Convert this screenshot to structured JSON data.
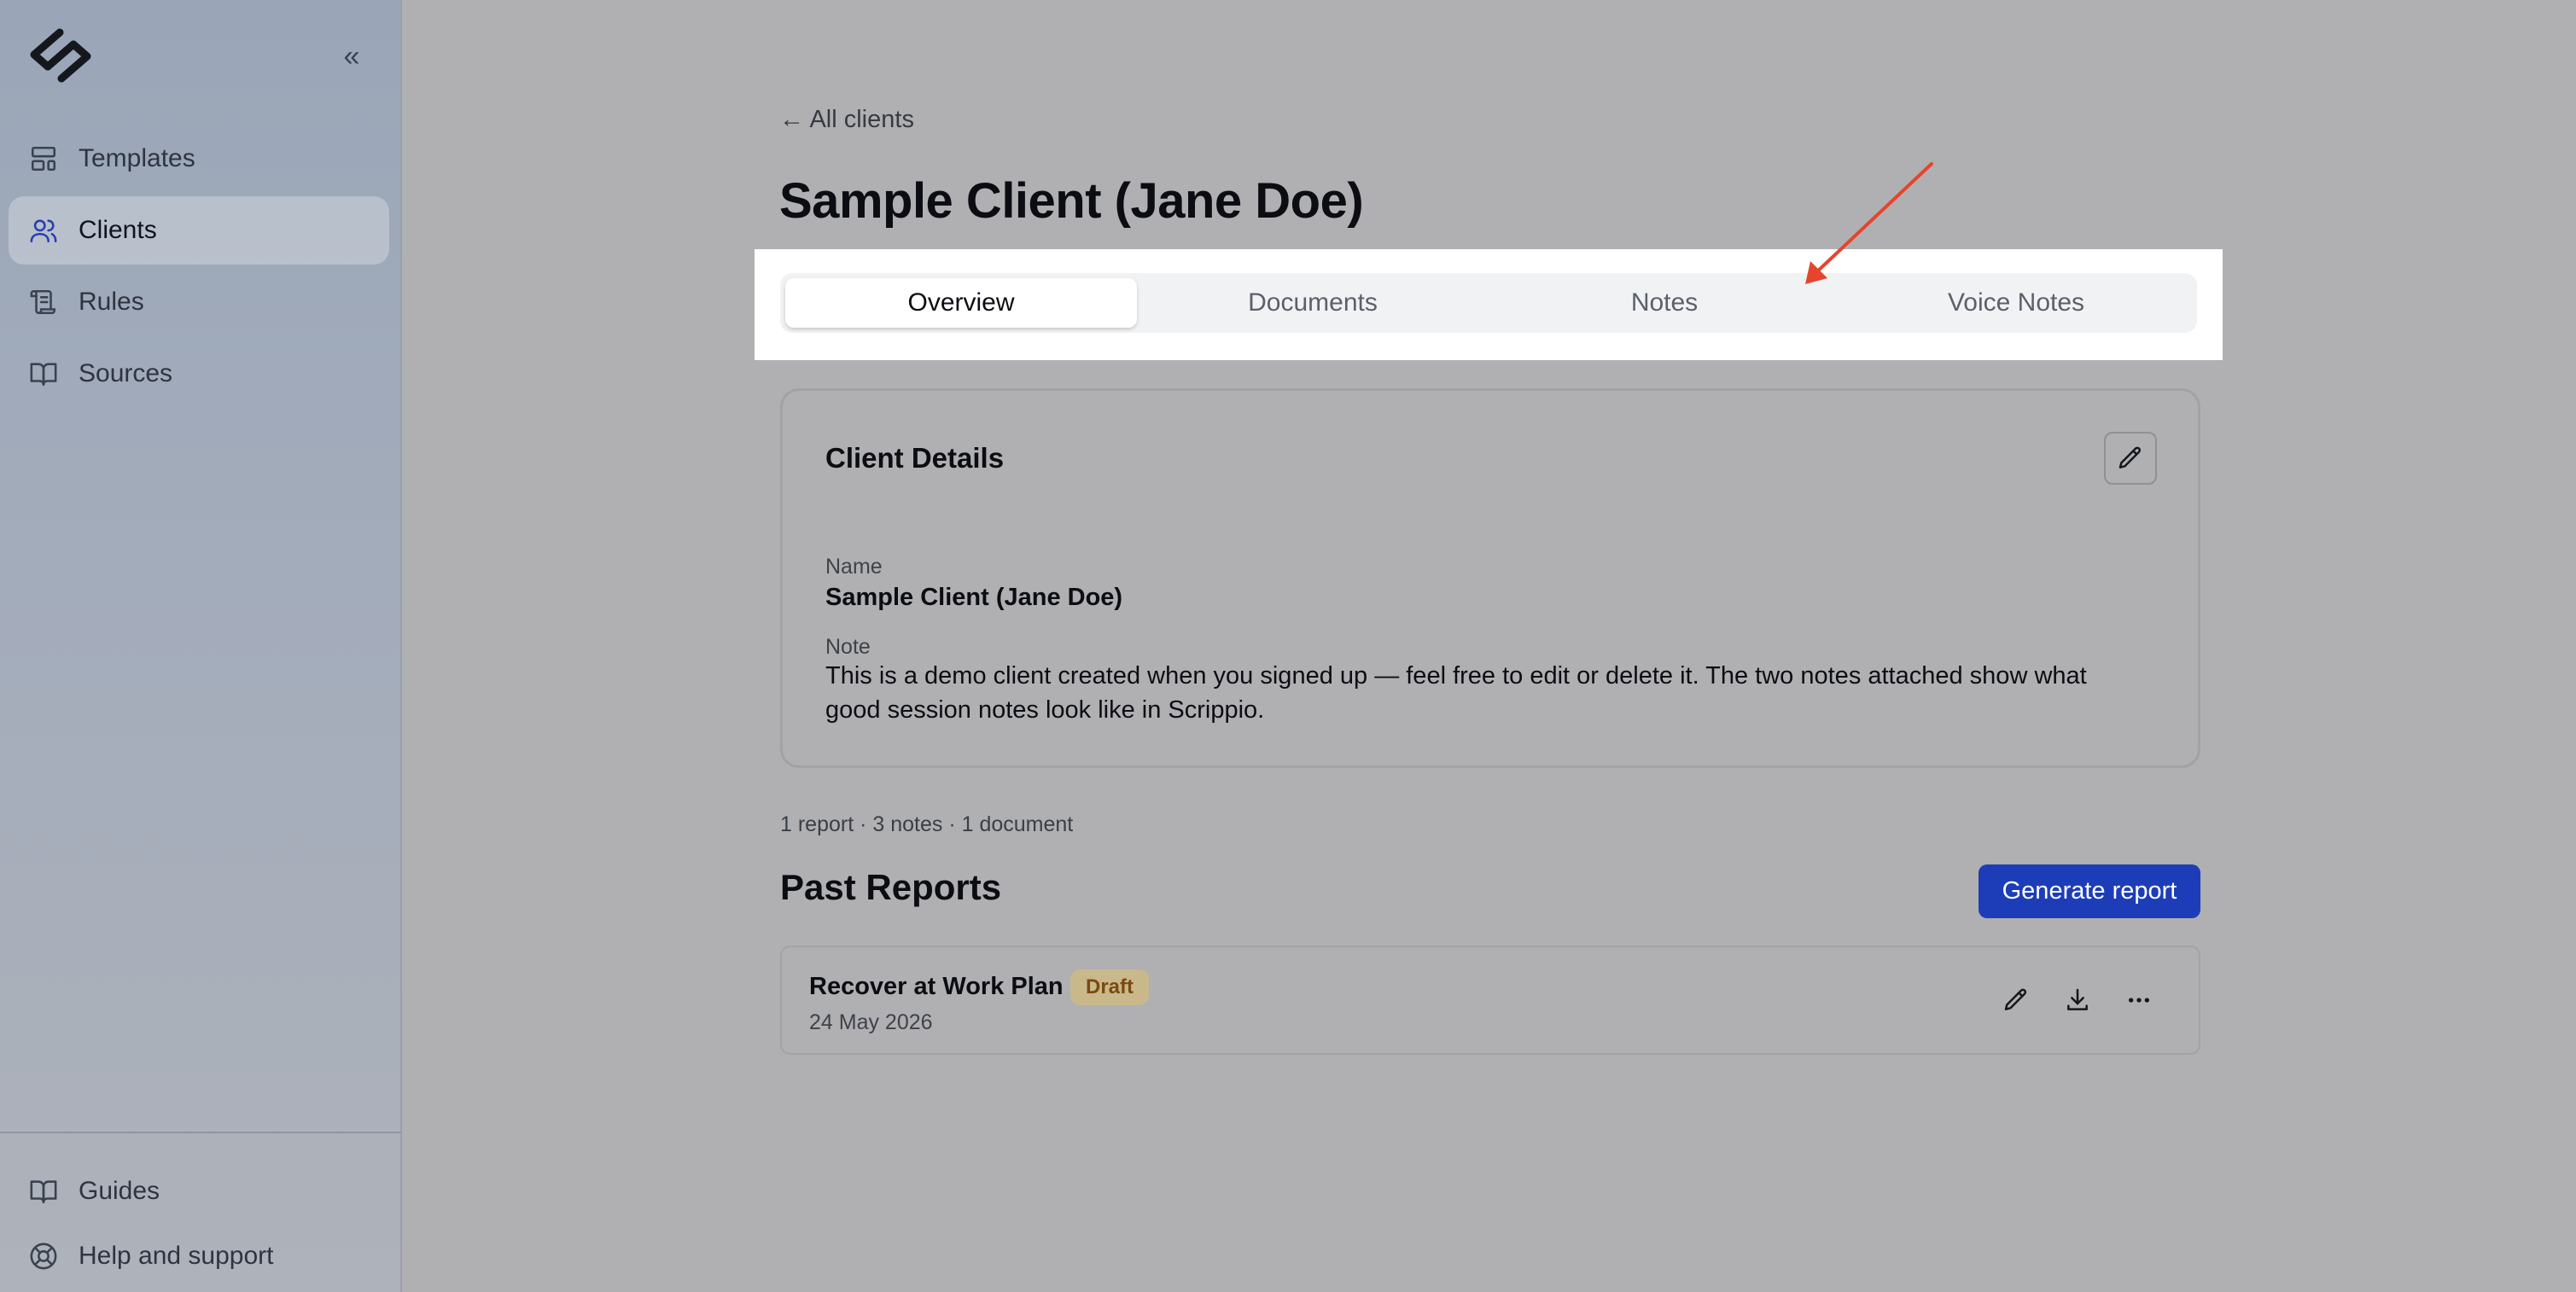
{
  "sidebar": {
    "collapse_glyph": "«",
    "items": [
      {
        "label": "Templates",
        "icon": "layout-template-icon"
      },
      {
        "label": "Clients",
        "icon": "users-icon",
        "active": true
      },
      {
        "label": "Rules",
        "icon": "scroll-icon"
      },
      {
        "label": "Sources",
        "icon": "book-open-icon"
      }
    ],
    "footer": [
      {
        "label": "Guides",
        "icon": "book-open-icon"
      },
      {
        "label": "Help and support",
        "icon": "life-buoy-icon"
      }
    ]
  },
  "header": {
    "back_label": "← All clients",
    "title": "Sample Client (Jane Doe)"
  },
  "tabs": [
    {
      "label": "Overview",
      "active": true
    },
    {
      "label": "Documents"
    },
    {
      "label": "Notes"
    },
    {
      "label": "Voice Notes"
    }
  ],
  "client_details": {
    "title": "Client Details",
    "name_label": "Name",
    "name_value": "Sample Client (Jane Doe)",
    "note_label": "Note",
    "note_value": "This is a demo client created when you signed up — feel free to edit or delete it. The two notes attached show what good session notes look like in Scrippio."
  },
  "summary": "1 report · 3 notes · 1 document",
  "past_reports": {
    "title": "Past Reports",
    "generate_label": "Generate report",
    "rows": [
      {
        "title": "Recover at Work Plan",
        "status": "Draft",
        "date": "24 May 2026"
      }
    ]
  },
  "colors": {
    "accent": "#1d3db8",
    "annotation_arrow": "#e5452c",
    "draft_badge_bg": "#c9b98a",
    "draft_badge_text": "#7a4a12"
  }
}
